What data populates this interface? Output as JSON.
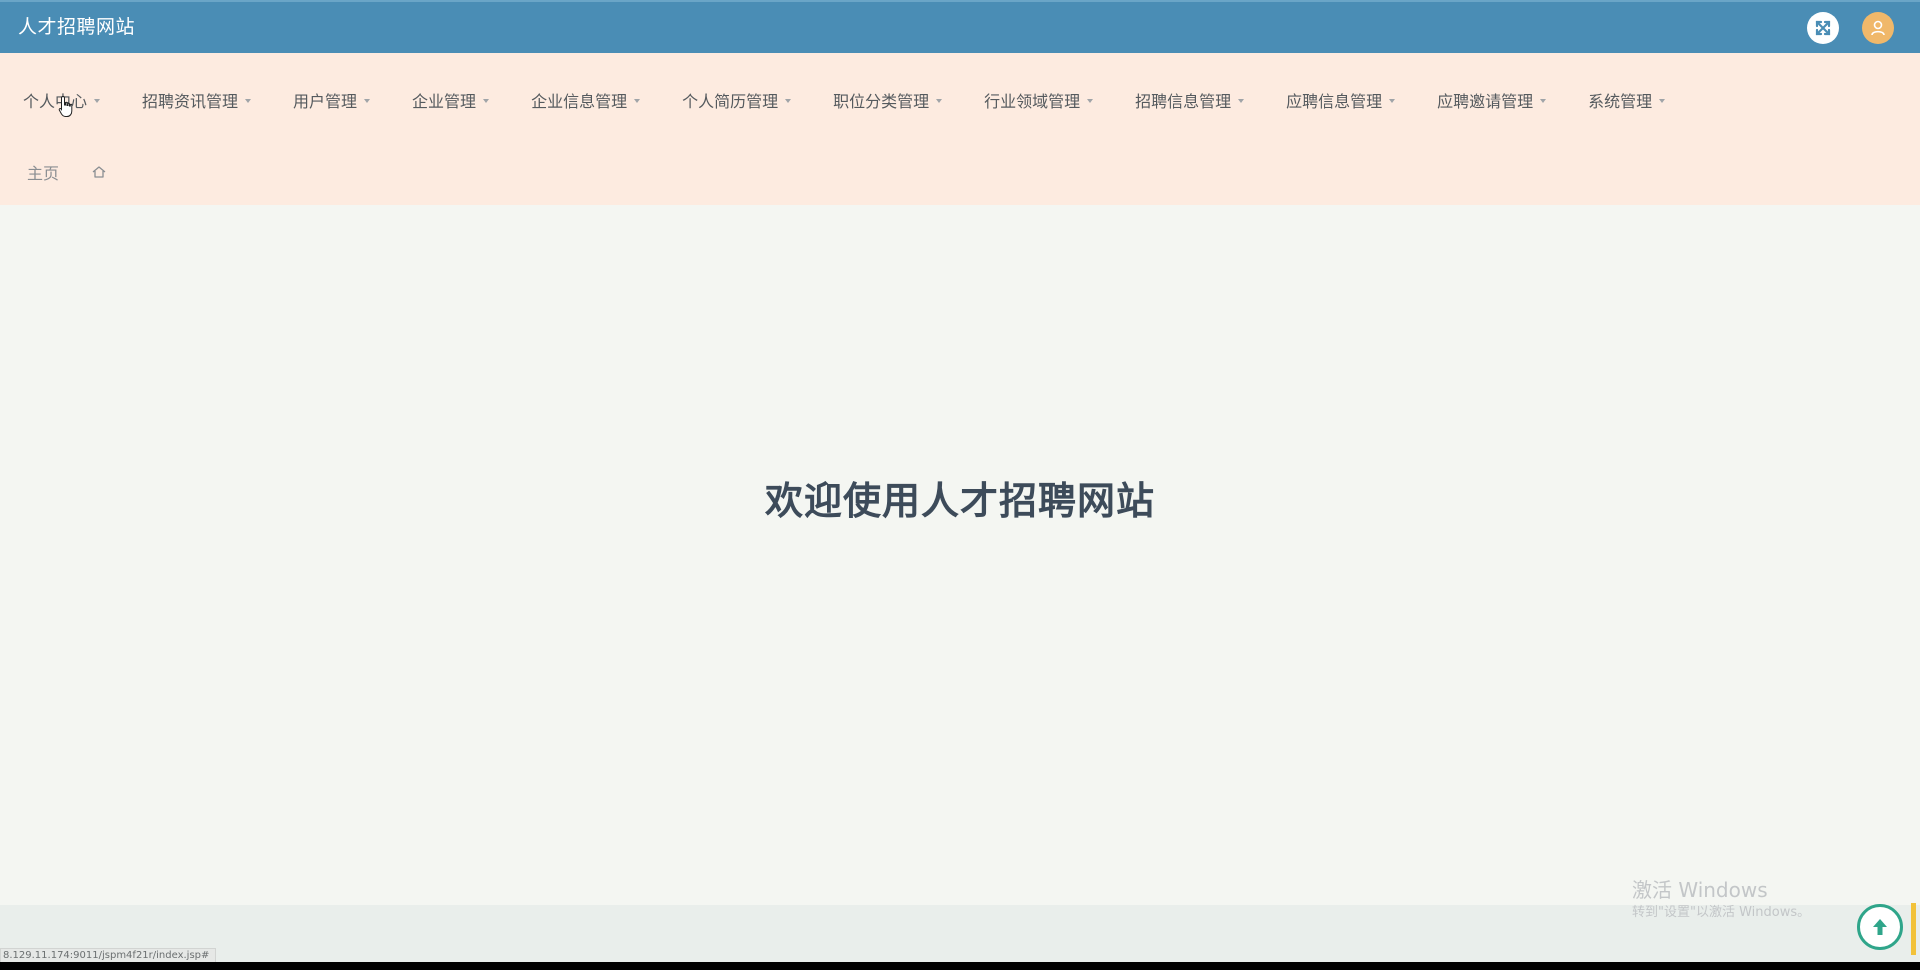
{
  "header": {
    "title": "人才招聘网站",
    "fullscreen_icon": "fullscreen-icon",
    "avatar_icon": "user-icon"
  },
  "menu": {
    "items": [
      {
        "label": "个人中心"
      },
      {
        "label": "招聘资讯管理"
      },
      {
        "label": "用户管理"
      },
      {
        "label": "企业管理"
      },
      {
        "label": "企业信息管理"
      },
      {
        "label": "个人简历管理"
      },
      {
        "label": "职位分类管理"
      },
      {
        "label": "行业领域管理"
      },
      {
        "label": "招聘信息管理"
      },
      {
        "label": "应聘信息管理"
      },
      {
        "label": "应聘邀请管理"
      },
      {
        "label": "系统管理"
      }
    ]
  },
  "breadcrumb": {
    "home_label": "主页"
  },
  "main": {
    "welcome": "欢迎使用人才招聘网站"
  },
  "watermark": {
    "title": "激活 Windows",
    "subtitle": "转到\"设置\"以激活 Windows。"
  },
  "status_bar": {
    "url": "8.129.11.174:9011/jspm4f21r/index.jsp#"
  },
  "colors": {
    "header": "#4a8db5",
    "nav_background": "#fdebe0",
    "content_background": "#f4f6f2",
    "scroll_top_accent": "#2fa58a"
  }
}
